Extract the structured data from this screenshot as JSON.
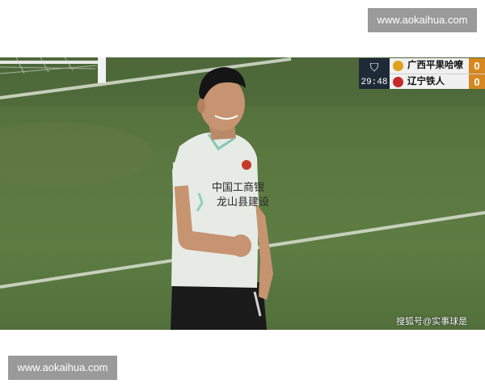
{
  "watermark": {
    "top": "www.aokaihua.com",
    "bottom": "www.aokaihua.com"
  },
  "scoreboard": {
    "clock": "29:48",
    "home": {
      "name": "广西平果哈嘹",
      "score": "0",
      "crest_color": "#e0a21b"
    },
    "away": {
      "name": "辽宁铁人",
      "score": "0",
      "crest_color": "#c62828"
    },
    "accent_color": "#d6871f"
  },
  "jersey": {
    "sponsor_line1": "中国工商银",
    "sponsor_line2": "龙山县建设"
  },
  "credit": "搜狐号@实事球是",
  "colors": {
    "pitch": "#5a7740",
    "shirt": "#e6ebe6",
    "shorts": "#1a1a1a",
    "watermark_bg": "#9a9a9a"
  }
}
